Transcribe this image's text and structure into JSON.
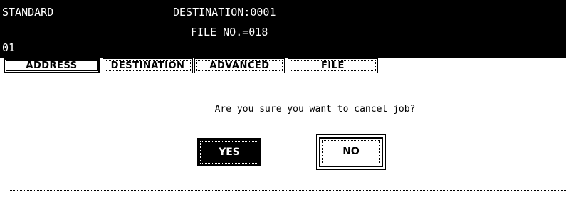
{
  "status": {
    "mode": "STANDARD",
    "destination": "DESTINATION:0001",
    "file_no": "FILE NO.=018",
    "count": "01"
  },
  "tabs": [
    {
      "label": "ADDRESS",
      "active": true
    },
    {
      "label": "DESTINATION",
      "active": false
    },
    {
      "label": "ADVANCED",
      "active": false
    },
    {
      "label": "FILE",
      "active": false
    }
  ],
  "dialog": {
    "message": "Are you sure you want to cancel job?",
    "yes_label": "YES",
    "no_label": "NO"
  },
  "colors": {
    "background": "#ffffff",
    "status_bar": "#000000",
    "text": "#000000"
  }
}
